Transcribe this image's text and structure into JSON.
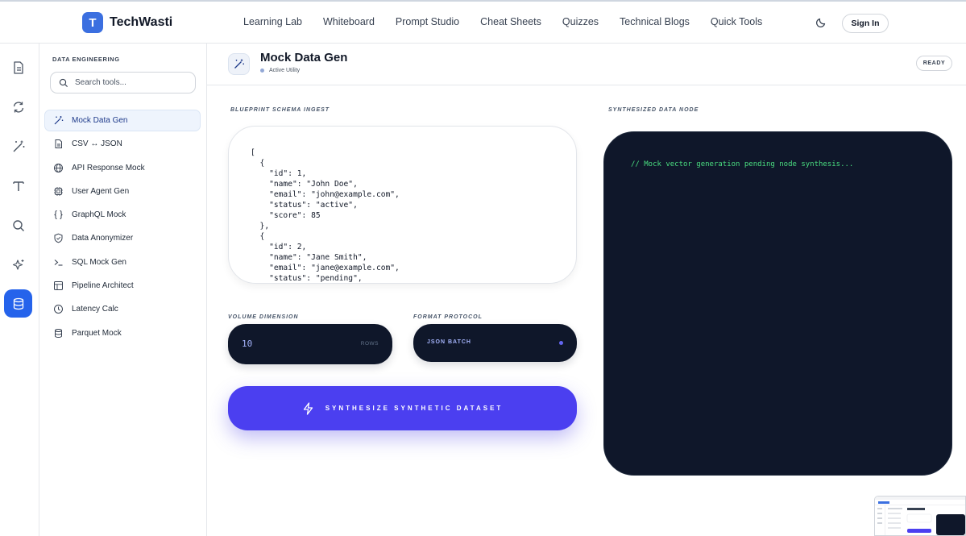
{
  "brand": {
    "logo_letter": "T",
    "name": "TechWasti"
  },
  "nav": {
    "links": [
      "Learning Lab",
      "Whiteboard",
      "Prompt Studio",
      "Cheat Sheets",
      "Quizzes",
      "Technical Blogs",
      "Quick Tools"
    ],
    "sign_in": "Sign In"
  },
  "sidebar": {
    "section_title": "DATA ENGINEERING",
    "search_placeholder": "Search tools...",
    "items": [
      {
        "label": "Mock Data Gen",
        "icon": "wand-icon",
        "active": true
      },
      {
        "label": "CSV ↔ JSON",
        "icon": "file-icon"
      },
      {
        "label": "API Response Mock",
        "icon": "globe-icon"
      },
      {
        "label": "User Agent Gen",
        "icon": "chip-icon"
      },
      {
        "label": "GraphQL Mock",
        "icon": "braces-icon"
      },
      {
        "label": "Data Anonymizer",
        "icon": "shield-icon"
      },
      {
        "label": "SQL Mock Gen",
        "icon": "terminal-icon"
      },
      {
        "label": "Pipeline Architect",
        "icon": "layout-icon"
      },
      {
        "label": "Latency Calc",
        "icon": "clock-icon"
      },
      {
        "label": "Parquet Mock",
        "icon": "database-icon"
      }
    ]
  },
  "tool": {
    "title": "Mock Data Gen",
    "status": "Active Utility",
    "badge": "READY"
  },
  "schema": {
    "label": "BLUEPRINT SCHEMA INGEST",
    "content": "[\n  {\n    \"id\": 1,\n    \"name\": \"John Doe\",\n    \"email\": \"john@example.com\",\n    \"status\": \"active\",\n    \"score\": 85\n  },\n  {\n    \"id\": 2,\n    \"name\": \"Jane Smith\",\n    \"email\": \"jane@example.com\",\n    \"status\": \"pending\","
  },
  "volume": {
    "label": "VOLUME DIMENSION",
    "value": "10",
    "unit": "ROWS"
  },
  "format": {
    "label": "FORMAT PROTOCOL",
    "value": "JSON BATCH"
  },
  "generate_button": "SYNTHESIZE SYNTHETIC DATASET",
  "output": {
    "label": "SYNTHESIZED DATA NODE",
    "placeholder": "// Mock vector generation pending node synthesis..."
  },
  "colors": {
    "accent": "#4b3ff0",
    "brand": "#3b6fe0",
    "terminal_bg": "#0f172a",
    "terminal_text": "#4ade80"
  }
}
